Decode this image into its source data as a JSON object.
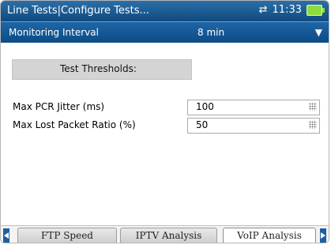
{
  "titlebar": {
    "title": "Line Tests|Configure Tests...",
    "time": "11:33"
  },
  "monitor": {
    "label": "Monitoring Interval",
    "value": "8 min"
  },
  "thresholds": {
    "heading": "Test Thresholds:",
    "rows": [
      {
        "label": "Max PCR  Jitter (ms)",
        "value": "100"
      },
      {
        "label": "Max Lost Packet Ratio (%)",
        "value": "50"
      }
    ]
  },
  "tabs": [
    "FTP Speed",
    "IPTV Analysis",
    "VoIP Analysis"
  ]
}
